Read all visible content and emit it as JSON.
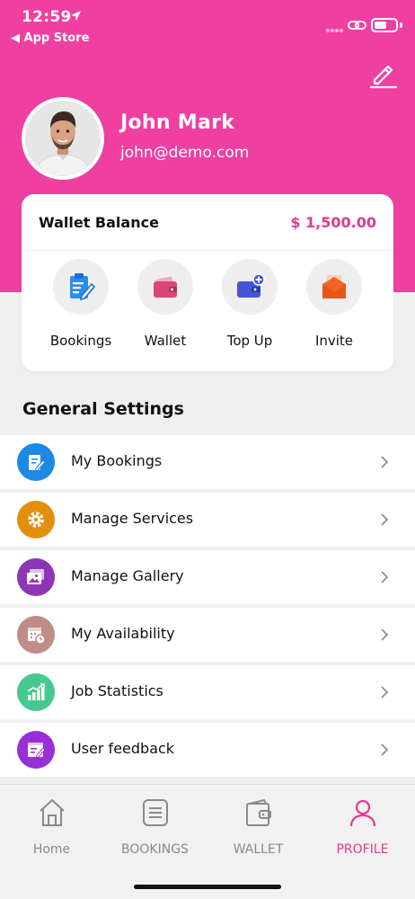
{
  "status_bar": {
    "time": "12:59",
    "back_app": "◀ App Store"
  },
  "profile": {
    "name": "John Mark",
    "email": "john@demo.com"
  },
  "wallet": {
    "title": "Wallet Balance",
    "balance": "$ 1,500.00"
  },
  "quick_actions": [
    {
      "label": "Bookings",
      "icon": "clipboard-edit-icon"
    },
    {
      "label": "Wallet",
      "icon": "wallet-icon"
    },
    {
      "label": "Top Up",
      "icon": "wallet-plus-icon"
    },
    {
      "label": "Invite",
      "icon": "envelope-icon"
    }
  ],
  "settings": {
    "title": "General Settings",
    "items": [
      {
        "label": "My Bookings",
        "icon": "clipboard-edit-icon",
        "color": "#1e88e5"
      },
      {
        "label": "Manage Services",
        "icon": "gear-icon",
        "color": "#e2900c"
      },
      {
        "label": "Manage Gallery",
        "icon": "gallery-icon",
        "color": "#8e35b5"
      },
      {
        "label": "My Availability",
        "icon": "calendar-clock-icon",
        "color": "#bf8c88"
      },
      {
        "label": "Job Statistics",
        "icon": "bar-chart-icon",
        "color": "#45c98f"
      },
      {
        "label": "User feedback",
        "icon": "feedback-icon",
        "color": "#9a2fd6"
      }
    ]
  },
  "tabs": [
    {
      "label": "Home",
      "icon": "home-icon",
      "active": false
    },
    {
      "label": "BOOKINGS",
      "icon": "list-icon",
      "active": false
    },
    {
      "label": "WALLET",
      "icon": "wallet-icon",
      "active": false
    },
    {
      "label": "PROFILE",
      "icon": "person-icon",
      "active": true
    }
  ],
  "colors": {
    "brand": "#ef3fa0",
    "accent": "#e6378e",
    "tab_inactive": "#8a8a8a"
  }
}
